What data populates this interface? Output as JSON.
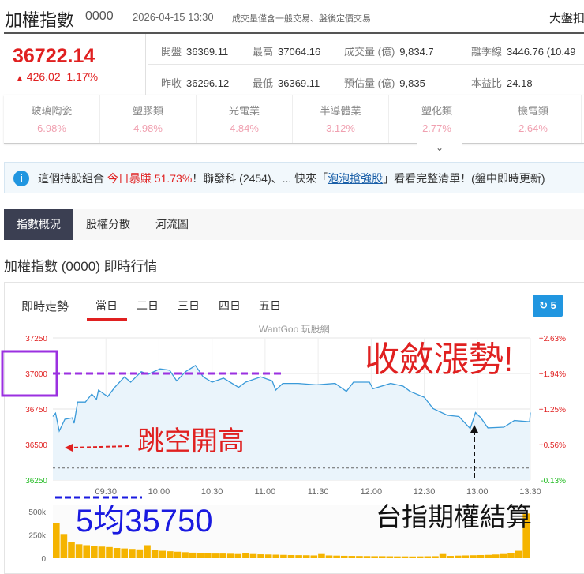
{
  "header": {
    "title": "加權指數",
    "code": "0000",
    "datetime": "2026-04-15 13:30",
    "note": "成交量僅含一般交易、盤後定價交易",
    "right": "大盤扣"
  },
  "quote": {
    "price": "36722.14",
    "change": "426.02",
    "change_pct": "1.17%",
    "up_arrow": "▲",
    "stats": [
      {
        "k": "開盤",
        "v": "36369.11"
      },
      {
        "k": "最高",
        "v": "37064.16"
      },
      {
        "k": "成交量 (億)",
        "v": "9,834.7"
      },
      {
        "k": "離季線",
        "v": "3446.76 (10.49"
      },
      {
        "k": "昨收",
        "v": "36296.12"
      },
      {
        "k": "最低",
        "v": "36369.11"
      },
      {
        "k": "預估量 (億)",
        "v": "9,835"
      },
      {
        "k": "本益比",
        "v": "24.18"
      }
    ]
  },
  "sectors": [
    {
      "name": "玻璃陶瓷",
      "pct": "6.98%"
    },
    {
      "name": "塑膠類",
      "pct": "4.98%"
    },
    {
      "name": "光電業",
      "pct": "4.84%"
    },
    {
      "name": "半導體業",
      "pct": "3.12%"
    },
    {
      "name": "塑化類",
      "pct": "2.77%"
    },
    {
      "name": "機電類",
      "pct": "2.64%"
    }
  ],
  "expand_icon": "chevron-down-icon",
  "banner": {
    "p1": "這個持股組合 ",
    "hl": "今日暴賺 51.73%",
    "p2": "！聯發科 (2454)、... 快來「",
    "link": "泡泡搶強股",
    "p3": "」看看完整清單！(盤中即時更新)"
  },
  "tabs": [
    "指數概況",
    "股權分散",
    "河流圖"
  ],
  "section_title": "加權指數 (0000) 即時行情",
  "chart_tabs": {
    "label": "即時走勢",
    "items": [
      "當日",
      "二日",
      "三日",
      "四日",
      "五日"
    ],
    "active": 0
  },
  "refresh": {
    "icon": "refresh-icon",
    "count": "5"
  },
  "watermark": "WantGoo 玩股網",
  "annotations": {
    "top_right": "收斂漲勢!",
    "left": "跳空開高",
    "ma5": "5均35750",
    "settle": "台指期權結算"
  },
  "colors": {
    "up": "#e02020",
    "down": "#22bb22",
    "line": "#3a9ad9",
    "volume": "#f5b400",
    "accent": "#2196e0"
  },
  "chart_data": [
    {
      "type": "line",
      "title": "加權指數 即時走勢",
      "ylim": [
        36250,
        37250
      ],
      "yticks": [
        "37250",
        "37000",
        "36750",
        "36500",
        "36250"
      ],
      "ytick_values": [
        37250,
        37000,
        36750,
        36500,
        36250
      ],
      "right_ticks": [
        "+2.63%",
        "+1.94%",
        "+1.25%",
        "+0.56%",
        "-0.13%"
      ],
      "xticks": [
        "09:30",
        "10:00",
        "10:30",
        "11:00",
        "11:30",
        "12:00",
        "12:30",
        "13:00",
        "13:30"
      ],
      "xlim_minutes": [
        0,
        270
      ],
      "prev_close": 36296.12,
      "ma5": 35750,
      "x_minutes": [
        0,
        1.5,
        3.6,
        6.8,
        11,
        12,
        14,
        18.4,
        22,
        24.7,
        25.8,
        31,
        35,
        40.5,
        44,
        50,
        54,
        60.6,
        66,
        70,
        75,
        80.6,
        85,
        90,
        96.5,
        105,
        109,
        117.6,
        124,
        126,
        130,
        138.7,
        149,
        159.6,
        166,
        170,
        179,
        181,
        191,
        198,
        202,
        210,
        215,
        223,
        229.6,
        236,
        239,
        242,
        246,
        255,
        261,
        269.6,
        270
      ],
      "y": [
        36697,
        36721,
        36595,
        36678,
        36688,
        36650,
        36799,
        36799,
        36855,
        36818,
        36883,
        36837,
        36902,
        36976,
        36939,
        37013,
        36995,
        37032,
        37023,
        36948,
        37013,
        37056,
        36976,
        36939,
        36967,
        36902,
        36939,
        36976,
        36948,
        36883,
        36930,
        36930,
        36920,
        36930,
        36874,
        36939,
        36939,
        36892,
        36930,
        36911,
        36874,
        36833,
        36753,
        36706,
        36697,
        36613,
        36725,
        36688,
        36617,
        36622,
        36669,
        36660,
        36725
      ]
    },
    {
      "type": "bar",
      "title": "成交量",
      "ylim": [
        0,
        500000
      ],
      "yticks": [
        "500k",
        "250k",
        "0"
      ],
      "ytick_values": [
        500000,
        250000,
        0
      ],
      "values": [
        380000,
        260000,
        170000,
        150000,
        140000,
        130000,
        125000,
        120000,
        110000,
        105000,
        100000,
        95000,
        140000,
        90000,
        80000,
        75000,
        70000,
        65000,
        60000,
        55000,
        55000,
        50000,
        50000,
        48000,
        45000,
        55000,
        45000,
        42000,
        40000,
        38000,
        36000,
        34000,
        33000,
        32000,
        30000,
        45000,
        30000,
        28000,
        26000,
        25000,
        24000,
        23000,
        22000,
        22000,
        21000,
        20000,
        20000,
        19000,
        20000,
        21000,
        22000,
        45000,
        25000,
        28000,
        30000,
        32000,
        34000,
        36000,
        40000,
        45000,
        55000,
        80000,
        480000
      ]
    }
  ]
}
